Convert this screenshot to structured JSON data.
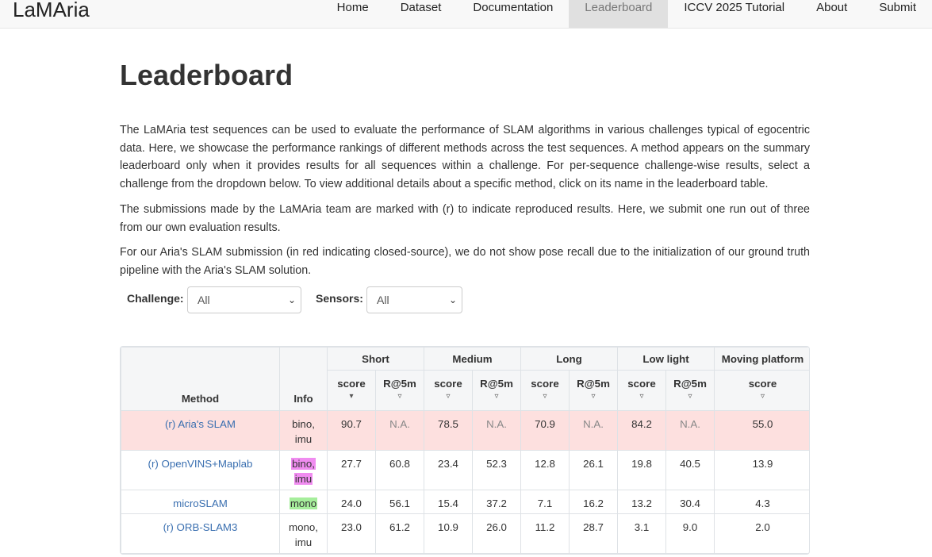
{
  "nav": {
    "brand": "LaMAria",
    "items": [
      "Home",
      "Dataset",
      "Documentation",
      "Leaderboard",
      "ICCV 2025 Tutorial",
      "About",
      "Submit"
    ],
    "active": "Leaderboard"
  },
  "page": {
    "title": "Leaderboard",
    "paragraphs": [
      "The LaMAria test sequences can be used to evaluate the performance of SLAM algorithms in various challenges typical of egocentric data. Here, we showcase the performance rankings of different methods across the test sequences. A method appears on the summary leaderboard only when it provides results for all sequences within a challenge. For per-sequence challenge-wise results, select a challenge from the dropdown below. To view additional details about a specific method, click on its name in the leaderboard table.",
      "The submissions made by the LaMAria team are marked with (r) to indicate reproduced results. Here, we submit one run out of three from our own evaluation results.",
      "For our Aria's SLAM submission (in red indicating closed-source), we do not show pose recall due to the initialization of our ground truth pipeline with the Aria's SLAM solution."
    ]
  },
  "filters": {
    "challenge": {
      "label": "Challenge:",
      "value": "All"
    },
    "sensors": {
      "label": "Sensors:",
      "value": "All"
    }
  },
  "table": {
    "headers": {
      "method": "Method",
      "info": "Info",
      "groups": [
        "Short",
        "Medium",
        "Long",
        "Low light",
        "Moving platform"
      ],
      "sub": [
        "score",
        "R@5m",
        "score",
        "R@5m",
        "score",
        "R@5m",
        "score",
        "R@5m",
        "score"
      ],
      "sorted_index": 0
    },
    "rows": [
      {
        "method": "(r) Aria's SLAM",
        "info": [
          "bino,",
          "imu"
        ],
        "info_style": "plain",
        "closed": true,
        "values": [
          "90.7",
          "N.A.",
          "78.5",
          "N.A.",
          "70.9",
          "N.A.",
          "84.2",
          "N.A.",
          "55.0"
        ]
      },
      {
        "method": "(r) OpenVINS+Maplab",
        "info": [
          "bino,",
          "imu"
        ],
        "info_style": "pink",
        "closed": false,
        "values": [
          "27.7",
          "60.8",
          "23.4",
          "52.3",
          "12.8",
          "26.1",
          "19.8",
          "40.5",
          "13.9"
        ]
      },
      {
        "method": "microSLAM",
        "info": [
          "mono"
        ],
        "info_style": "green",
        "closed": false,
        "values": [
          "24.0",
          "56.1",
          "15.4",
          "37.2",
          "7.1",
          "16.2",
          "13.2",
          "30.4",
          "4.3"
        ]
      },
      {
        "method": "(r) ORB-SLAM3",
        "info": [
          "mono,",
          "imu"
        ],
        "info_style": "plain",
        "closed": false,
        "values": [
          "23.0",
          "61.2",
          "10.9",
          "26.0",
          "11.2",
          "28.7",
          "3.1",
          "9.0",
          "2.0"
        ]
      }
    ]
  },
  "colors": {
    "closed_row": "#fde0df",
    "link": "#3a6fb0",
    "tag_pink": "#f08cf0",
    "tag_green": "#a6ee9c"
  }
}
